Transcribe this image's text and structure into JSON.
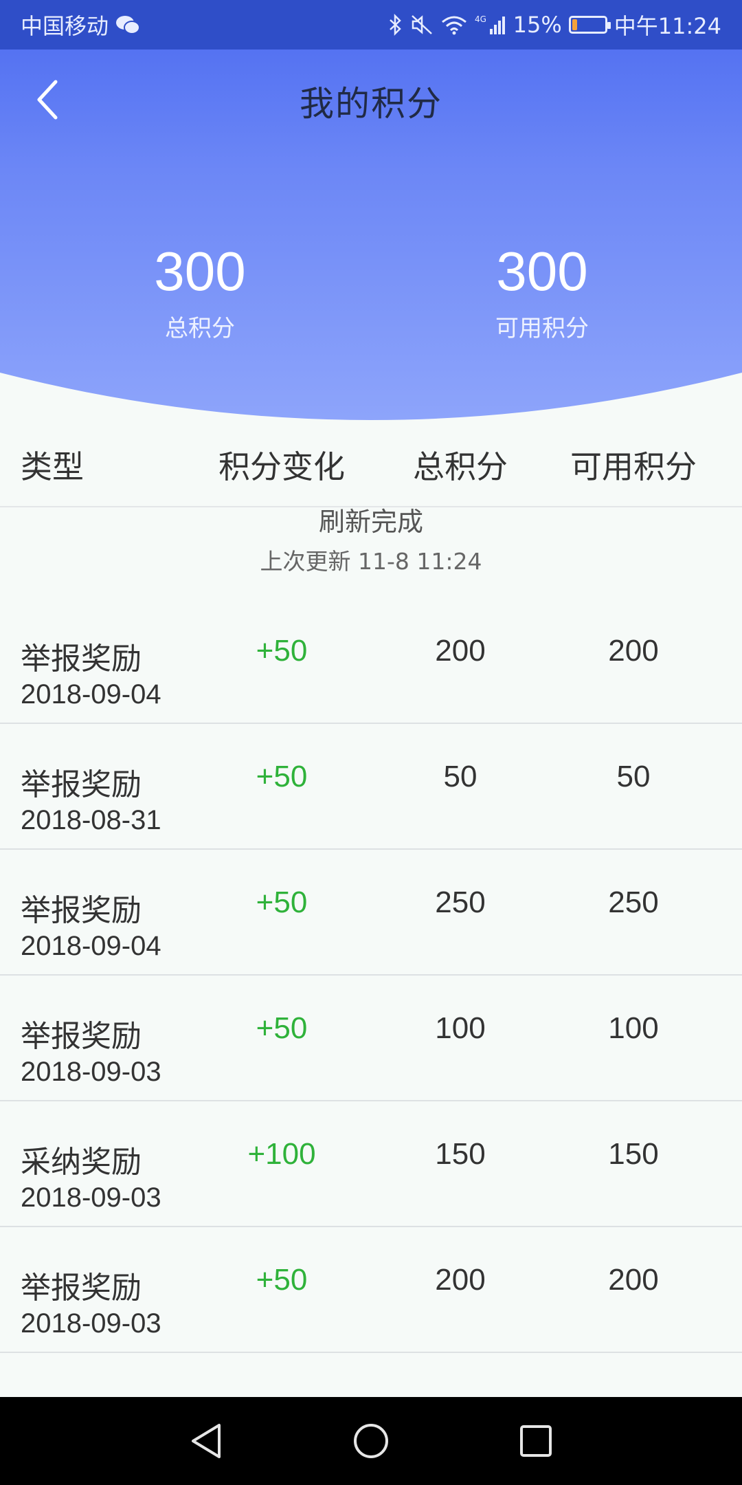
{
  "status_bar": {
    "carrier": "中国移动",
    "network": "4G",
    "battery": "15%",
    "battery_level": 0.15,
    "time": "中午11:24",
    "icons": [
      "wechat-icon",
      "bluetooth-icon",
      "mute-icon",
      "wifi-icon",
      "signal-icon",
      "battery-icon"
    ]
  },
  "header": {
    "title": "我的积分",
    "back_icon": "chevron-left-icon"
  },
  "totals": {
    "total_value": "300",
    "total_label": "总积分",
    "available_value": "300",
    "available_label": "可用积分"
  },
  "table": {
    "headers": {
      "type": "类型",
      "change": "积分变化",
      "total": "总积分",
      "available": "可用积分"
    }
  },
  "refresh": {
    "title": "刷新完成",
    "last_update": "上次更新 11-8 11:24"
  },
  "records": [
    {
      "type": "举报奖励",
      "date": "2018-09-04",
      "change": "+50",
      "total": "200",
      "available": "200"
    },
    {
      "type": "举报奖励",
      "date": "2018-08-31",
      "change": "+50",
      "total": "50",
      "available": "50"
    },
    {
      "type": "举报奖励",
      "date": "2018-09-04",
      "change": "+50",
      "total": "250",
      "available": "250"
    },
    {
      "type": "举报奖励",
      "date": "2018-09-03",
      "change": "+50",
      "total": "100",
      "available": "100"
    },
    {
      "type": "采纳奖励",
      "date": "2018-09-03",
      "change": "+100",
      "total": "150",
      "available": "150"
    },
    {
      "type": "举报奖励",
      "date": "2018-09-03",
      "change": "+50",
      "total": "200",
      "available": "200"
    }
  ],
  "colors": {
    "header_blue": "#4b6af0",
    "status_blue": "#2f4ec8",
    "positive_green": "#2fb23a",
    "background": "#f6faf8"
  },
  "nav": {
    "icons": [
      "back-triangle-icon",
      "home-circle-icon",
      "recents-square-icon"
    ]
  }
}
